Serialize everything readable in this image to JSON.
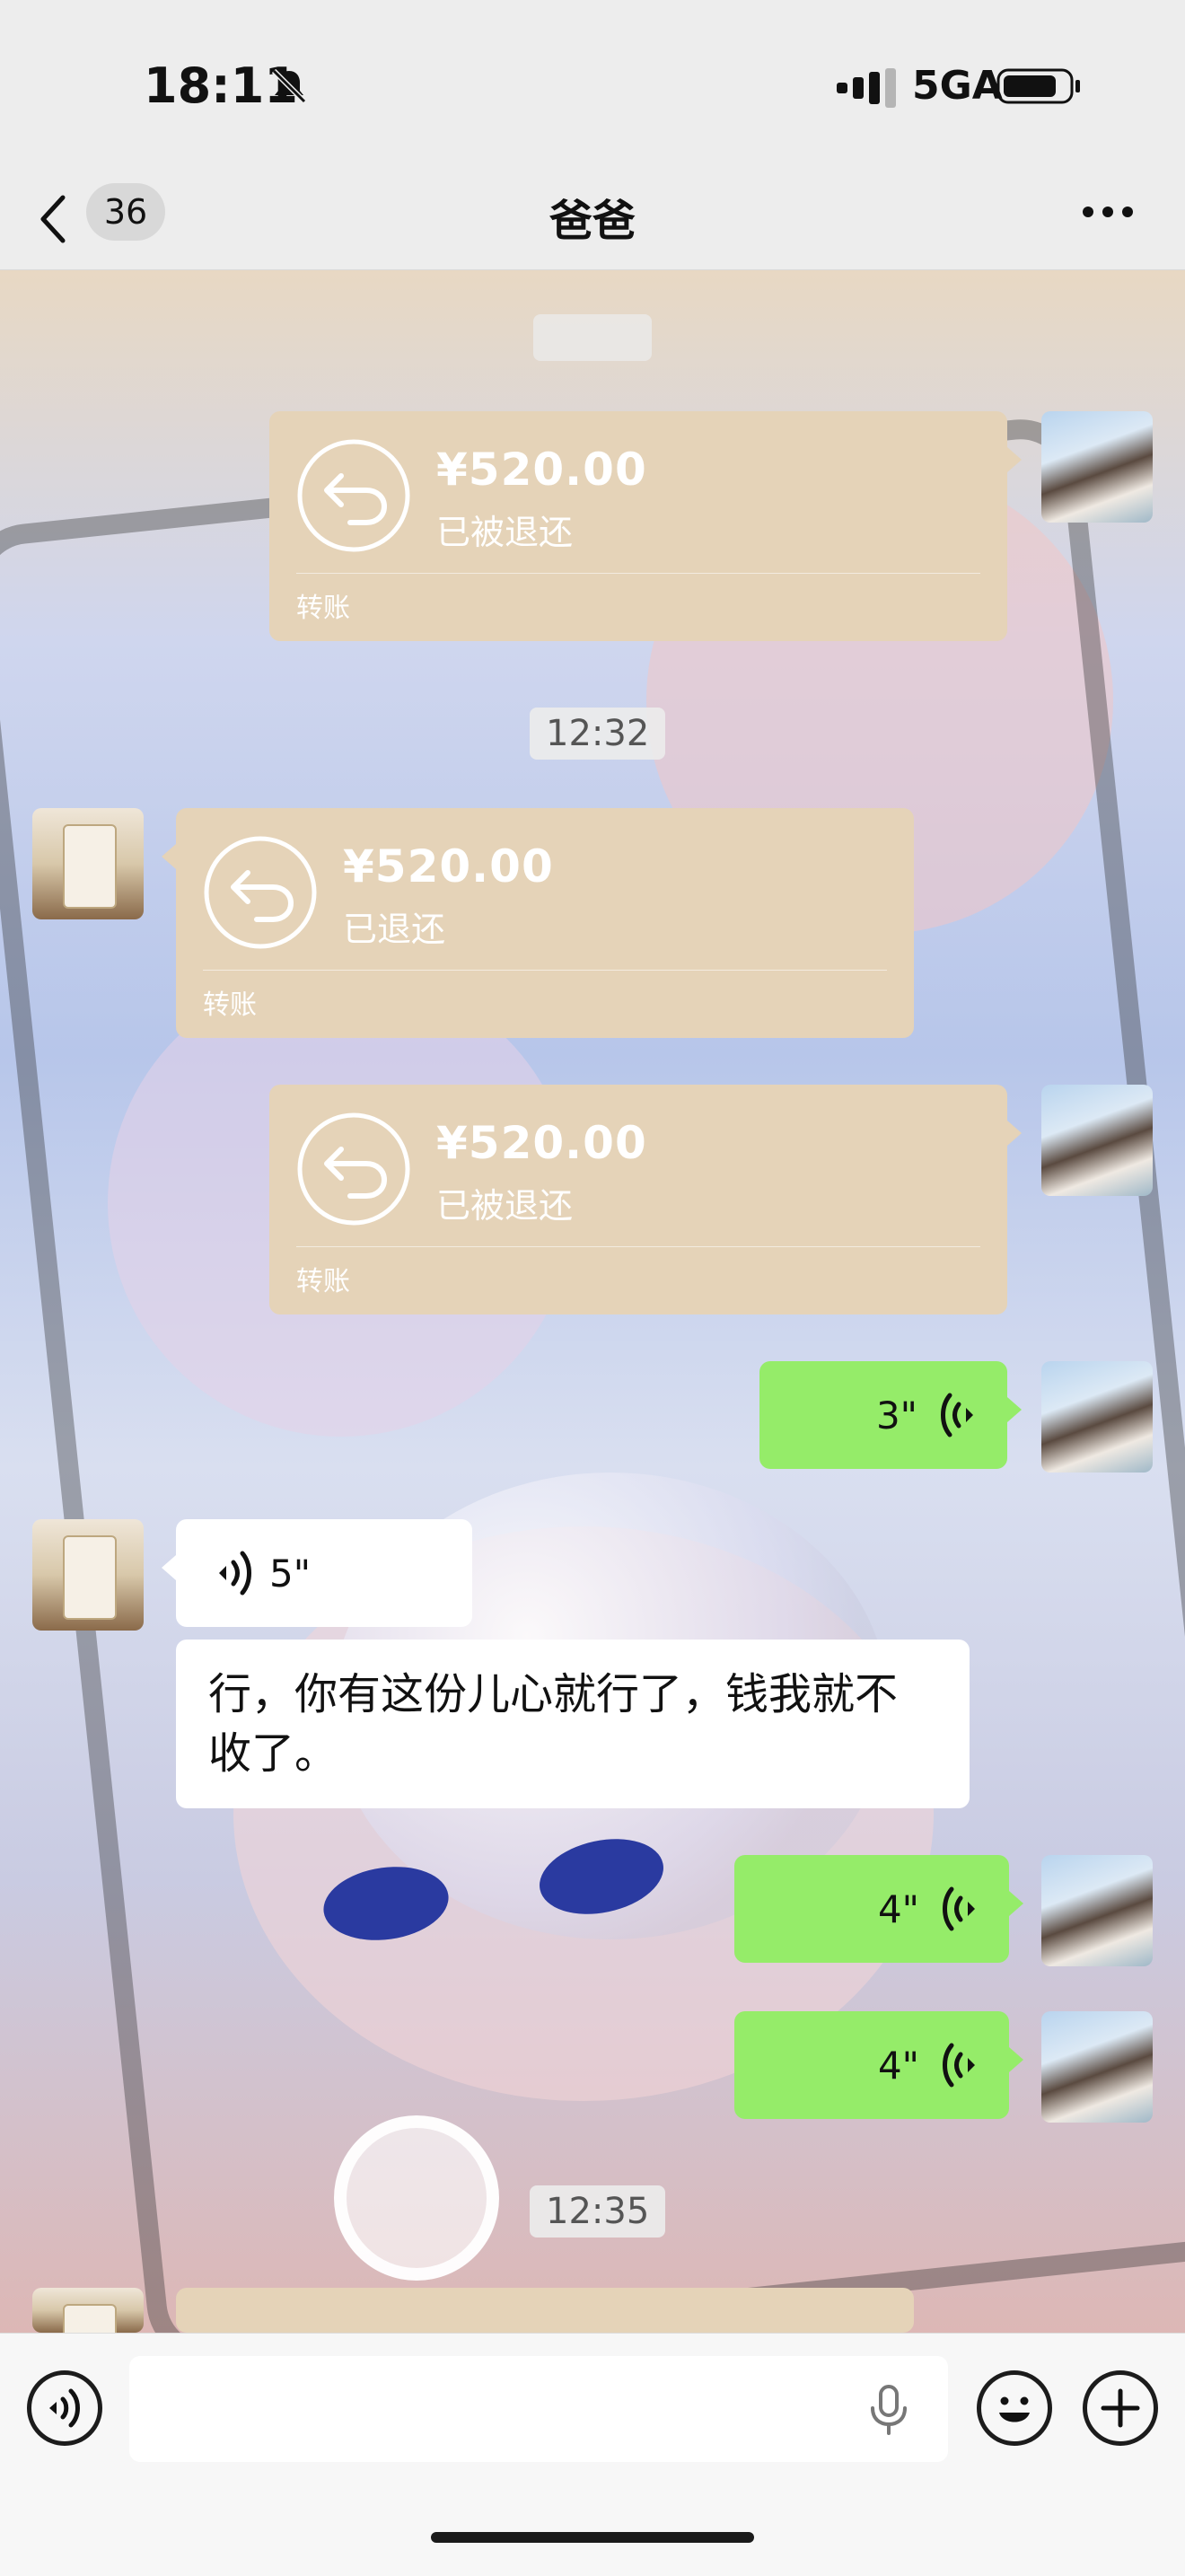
{
  "status_bar": {
    "time": "18:11",
    "network": "5GA",
    "icons": [
      "bell-muted-icon",
      "signal-icon",
      "battery-icon"
    ]
  },
  "header": {
    "unread_count": "36",
    "title": "爸爸",
    "icons": [
      "chevron-left-icon",
      "more-icon"
    ]
  },
  "messages": {
    "transfer_1": {
      "amount": "¥520.00",
      "status": "已被退还",
      "kind": "转账"
    },
    "time_1": "12:32",
    "transfer_2": {
      "amount": "¥520.00",
      "status": "已退还",
      "kind": "转账"
    },
    "transfer_3": {
      "amount": "¥520.00",
      "status": "已被退还",
      "kind": "转账"
    },
    "voice_out_1": "3\"",
    "voice_in_1": "5\"",
    "text_in_1": "行，你有这份儿心就行了，钱我就不收了。",
    "voice_out_2": "4\"",
    "voice_out_3": "4\"",
    "time_2": "12:35"
  },
  "input_bar": {
    "icons": [
      "voice-mode-icon",
      "microphone-icon",
      "emoji-icon",
      "plus-icon"
    ]
  },
  "colors": {
    "transfer_card": "#e5d3b8",
    "outgoing_bubble": "#95ec69",
    "incoming_bubble": "#ffffff",
    "bar_background": "#ededed"
  }
}
